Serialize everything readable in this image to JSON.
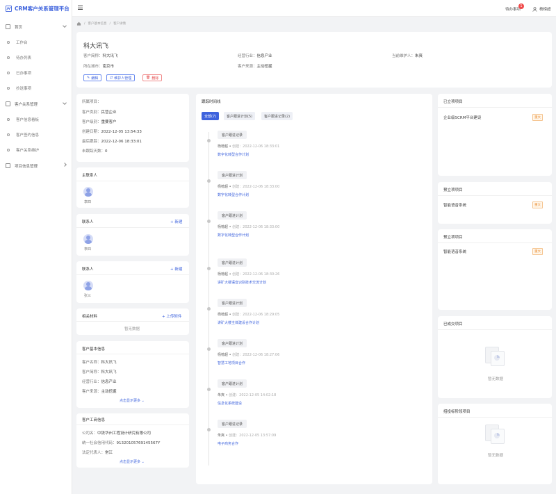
{
  "app_title": "CRM客户关系管理平台",
  "sidebar": {
    "home": "首页",
    "workbench": "工作台",
    "todo_list": "待办列表",
    "done": "已办事项",
    "cc": "抄送事项",
    "customer_mgmt": "客户关系管理",
    "customer_board": "客户信息看板",
    "customer_sign": "客户签约信息",
    "customer_maint": "客户关系维护",
    "project_mgmt": "项目信息管理"
  },
  "topbar": {
    "todo": "待办事项",
    "todo_count": "1",
    "user": "杨榜超"
  },
  "breadcrumb": {
    "b1": "客户基本信息",
    "b2": "客户详情"
  },
  "header": {
    "name": "科大讯飞",
    "short_name_label": "客户简称：",
    "short_name": "科大讯飞",
    "industry_label": "经营行业：",
    "industry": "信息产业",
    "maintainer_label": "当前维护人：",
    "maintainer": "朱爽",
    "city_label": "所在城市：",
    "city": "南京市",
    "source_label": "客户来源：",
    "source": "主动挖掘",
    "btn_edit": "编辑",
    "btn_maint": "维护人管理",
    "btn_delete": "删除"
  },
  "info": {
    "project": "所属项目：",
    "type_label": "客户类别：",
    "type": "民营企业",
    "level_label": "客户级别：",
    "level": "重要客户",
    "created_label": "创建日期：",
    "created": "2022-12-05 13:54:33",
    "followup_label": "最后跟踪：",
    "followup": "2022-12-06 18:33:01",
    "nofollow_label": "未跟踪天数：",
    "nofollow": "0"
  },
  "main_contact": {
    "title": "主联系人",
    "name": "李四"
  },
  "contact1": {
    "title": "联系人",
    "add": "+ 新建",
    "name": "李四"
  },
  "contact2": {
    "title": "联系人",
    "add": "+ 新建",
    "name": "张三"
  },
  "materials": {
    "title": "相关材料",
    "upload": "+ 上传附件",
    "empty": "暂无数据"
  },
  "basic": {
    "title": "客户基本信息",
    "name_label": "客户名称：",
    "name": "科大讯飞",
    "short_label": "客户简称：",
    "short": "科大讯飞",
    "industry_label": "经营行业：",
    "industry": "信息产业",
    "source_label": "客户来源：",
    "source": "主动挖掘",
    "more": "点击显示更多"
  },
  "business": {
    "title": "客户工商信息",
    "company_label": "公司名：",
    "company": "中铁华州工程设计研究有限公司",
    "code_label": "统一社会信用代码：",
    "code": "91320105769145567Y",
    "legal_label": "法定代表人：",
    "legal": "常江",
    "more": "点击显示更多"
  },
  "timeline": {
    "title": "跟踪时间线",
    "tabs": [
      "全部(7)",
      "客户跟进计划(5)",
      "客户跟进记录(2)"
    ],
    "items": [
      {
        "type": "客户跟进记录",
        "user": "杨榜超",
        "time": "创建：2022-12-06 18:33:01",
        "link": "数字化转型合作计划"
      },
      {
        "type": "客户跟进计划",
        "user": "杨榜超",
        "time": "创建：2022-12-06 18:33:00",
        "link": "数字化转型合作计划"
      },
      {
        "type": "客户跟进计划",
        "user": "杨榜超",
        "time": "创建：2022-12-06 18:33:00",
        "link": "数字化转型合作计划"
      },
      {
        "type": "客户跟进计划",
        "user": "杨榜超",
        "time": "创建：2022-12-06 18:30:26",
        "link": "讲矿大楼语音识别技术交流计划"
      },
      {
        "type": "客户跟进计划",
        "user": "杨榜超",
        "time": "创建：2022-12-06 18:29:05",
        "link": "讲矿大楼主体建设合作计划"
      },
      {
        "type": "客户跟进计划",
        "user": "杨榜超",
        "time": "创建：2022-12-06 18:27:06",
        "link": "智慧工地项目合作"
      },
      {
        "type": "客户跟进计划",
        "user": "朱爽",
        "time": "创建：2022-12-05 14:02:18",
        "link": "信息化系统建设"
      },
      {
        "type": "客户跟进记录",
        "user": "朱爽",
        "time": "创建：2022-12-05 13:57:09",
        "link": "电子商务合作"
      }
    ]
  },
  "right": {
    "established": {
      "title": "已立项项目",
      "item": "企业级SCRM平台建设",
      "tag": "重大"
    },
    "pre1": {
      "title": "预立项项目",
      "item": "智能语音系统",
      "tag": "重大"
    },
    "pre2": {
      "title": "预立项项目",
      "item": "智能语音系统",
      "tag": "重大"
    },
    "deals": {
      "title": "已成交项目",
      "empty": "暂无数据"
    },
    "bidding": {
      "title": "招投标阶段项目",
      "empty": "暂无数据"
    }
  }
}
